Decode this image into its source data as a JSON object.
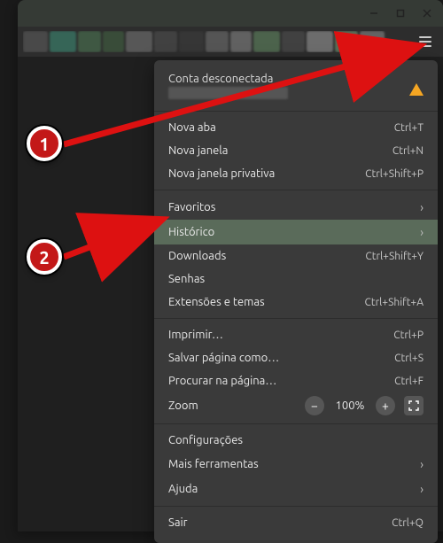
{
  "account": {
    "title": "Conta desconectada"
  },
  "menu": {
    "newTab": {
      "label": "Nova aba",
      "shortcut": "Ctrl+T"
    },
    "newWindow": {
      "label": "Nova janela",
      "shortcut": "Ctrl+N"
    },
    "newPrivate": {
      "label": "Nova janela privativa",
      "shortcut": "Ctrl+Shift+P"
    },
    "bookmarks": {
      "label": "Favoritos"
    },
    "history": {
      "label": "Histórico"
    },
    "downloads": {
      "label": "Downloads",
      "shortcut": "Ctrl+Shift+Y"
    },
    "passwords": {
      "label": "Senhas"
    },
    "extensions": {
      "label": "Extensões e temas",
      "shortcut": "Ctrl+Shift+A"
    },
    "print": {
      "label": "Imprimir…",
      "shortcut": "Ctrl+P"
    },
    "savePage": {
      "label": "Salvar página como…",
      "shortcut": "Ctrl+S"
    },
    "findInPage": {
      "label": "Procurar na página…",
      "shortcut": "Ctrl+F"
    },
    "zoom": {
      "label": "Zoom",
      "value": "100%"
    },
    "settings": {
      "label": "Configurações"
    },
    "moreTools": {
      "label": "Mais ferramentas"
    },
    "help": {
      "label": "Ajuda"
    },
    "quit": {
      "label": "Sair",
      "shortcut": "Ctrl+Q"
    }
  },
  "callouts": {
    "one": "1",
    "two": "2"
  }
}
